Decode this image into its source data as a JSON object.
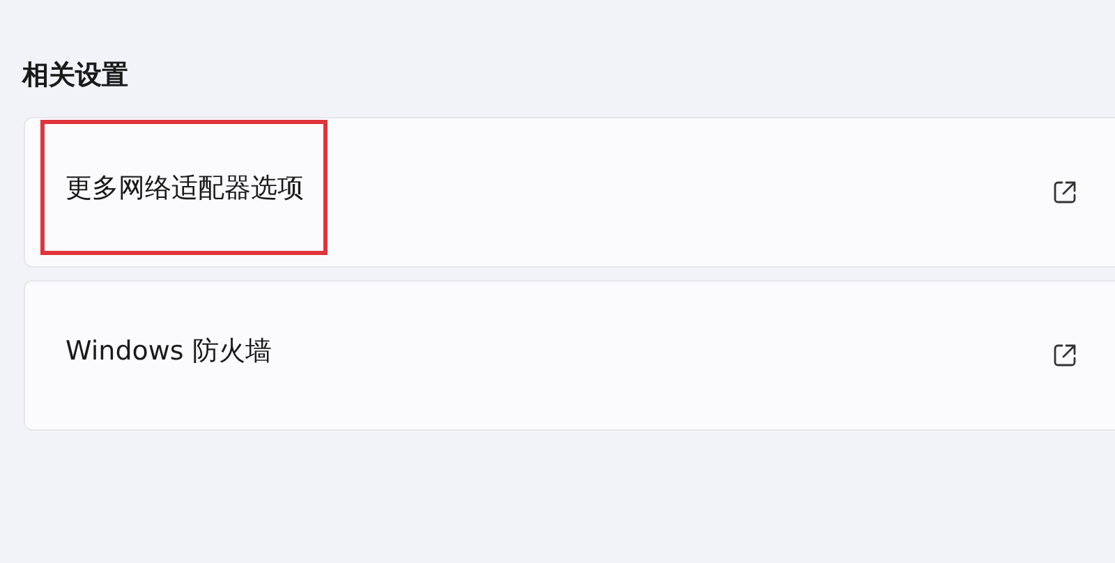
{
  "section": {
    "title": "相关设置"
  },
  "items": [
    {
      "label": "更多网络适配器选项",
      "highlighted": true
    },
    {
      "label": "Windows 防火墙",
      "highlighted": false
    }
  ]
}
